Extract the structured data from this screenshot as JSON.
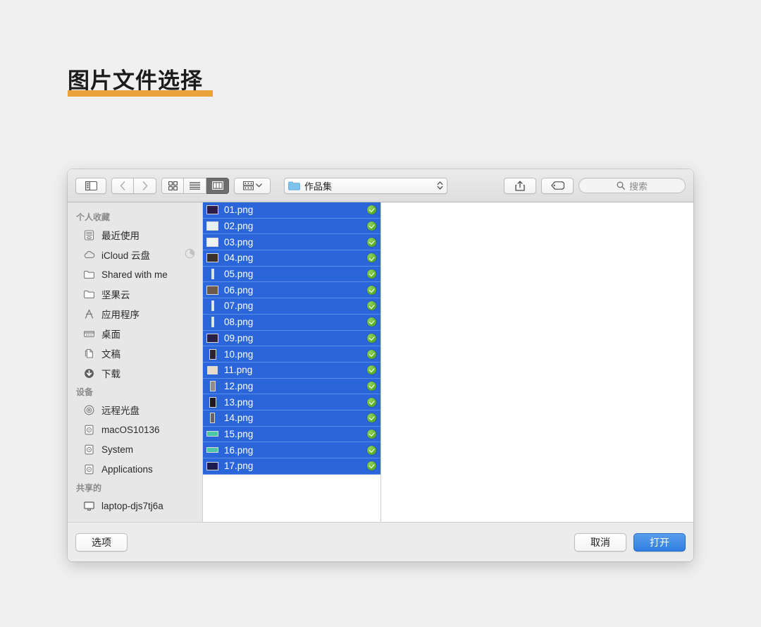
{
  "page": {
    "heading": "图片文件选择",
    "heading_underline_color": "#eaa33c",
    "background_color": "#f0f0f0"
  },
  "dialog": {
    "toolbar": {
      "sidebar_toggle": "sidebar-toggle",
      "back_label": "‹",
      "forward_label": "›",
      "view_modes": [
        {
          "name": "icon-view",
          "active": false
        },
        {
          "name": "list-view",
          "active": false
        },
        {
          "name": "column-view",
          "active": true
        }
      ],
      "group_button": "group-by",
      "path_popup": {
        "label": "作品集",
        "folder_color": "#6cb8e8"
      },
      "share_button": "share",
      "tag_button": "tag",
      "search": {
        "placeholder": "搜索"
      }
    },
    "sidebar": {
      "sections": [
        {
          "title": "个人收藏",
          "items": [
            {
              "label": "最近使用",
              "icon": "recents-icon"
            },
            {
              "label": "iCloud 云盘",
              "icon": "icloud-icon",
              "badge": "sync-progress"
            },
            {
              "label": "Shared with me",
              "icon": "folder-icon"
            },
            {
              "label": "坚果云",
              "icon": "folder-icon"
            },
            {
              "label": "应用程序",
              "icon": "applications-icon"
            },
            {
              "label": "桌面",
              "icon": "desktop-icon"
            },
            {
              "label": "文稿",
              "icon": "documents-icon"
            },
            {
              "label": "下载",
              "icon": "downloads-icon"
            }
          ]
        },
        {
          "title": "设备",
          "items": [
            {
              "label": "远程光盘",
              "icon": "disc-icon"
            },
            {
              "label": "macOS10136",
              "icon": "harddisk-icon"
            },
            {
              "label": "System",
              "icon": "harddisk-icon"
            },
            {
              "label": "Applications",
              "icon": "harddisk-icon"
            }
          ]
        },
        {
          "title": "共享的",
          "items": [
            {
              "label": "laptop-djs7tj6a",
              "icon": "display-icon"
            }
          ]
        }
      ]
    },
    "file_list": {
      "selected_all": true,
      "files": [
        {
          "name": "01.png",
          "selected": true,
          "checked": true,
          "thumb": {
            "w": 17,
            "h": 13,
            "color": "#2d1a47"
          }
        },
        {
          "name": "02.png",
          "selected": true,
          "checked": true,
          "thumb": {
            "w": 17,
            "h": 13,
            "color": "#e8eef5"
          }
        },
        {
          "name": "03.png",
          "selected": true,
          "checked": true,
          "thumb": {
            "w": 17,
            "h": 13,
            "color": "#eef2f6"
          }
        },
        {
          "name": "04.png",
          "selected": true,
          "checked": true,
          "thumb": {
            "w": 17,
            "h": 13,
            "color": "#3a2f2a"
          }
        },
        {
          "name": "05.png",
          "selected": true,
          "checked": true,
          "thumb": {
            "w": 4,
            "h": 15,
            "color": "#dfe6ee"
          }
        },
        {
          "name": "06.png",
          "selected": true,
          "checked": true,
          "thumb": {
            "w": 17,
            "h": 13,
            "color": "#6d5a4a"
          }
        },
        {
          "name": "07.png",
          "selected": true,
          "checked": true,
          "thumb": {
            "w": 4,
            "h": 15,
            "color": "#e4eaf2"
          }
        },
        {
          "name": "08.png",
          "selected": true,
          "checked": true,
          "thumb": {
            "w": 4,
            "h": 15,
            "color": "#e4eaf2"
          }
        },
        {
          "name": "09.png",
          "selected": true,
          "checked": true,
          "thumb": {
            "w": 17,
            "h": 13,
            "color": "#2a1f4a"
          }
        },
        {
          "name": "10.png",
          "selected": true,
          "checked": true,
          "thumb": {
            "w": 10,
            "h": 15,
            "color": "#2b2438"
          }
        },
        {
          "name": "11.png",
          "selected": true,
          "checked": true,
          "thumb": {
            "w": 15,
            "h": 12,
            "color": "#e8d9c8"
          }
        },
        {
          "name": "12.png",
          "selected": true,
          "checked": true,
          "thumb": {
            "w": 8,
            "h": 15,
            "color": "#8d8d86"
          }
        },
        {
          "name": "13.png",
          "selected": true,
          "checked": true,
          "thumb": {
            "w": 10,
            "h": 15,
            "color": "#1d1a1e"
          }
        },
        {
          "name": "14.png",
          "selected": true,
          "checked": true,
          "thumb": {
            "w": 7,
            "h": 15,
            "color": "#6b625c"
          }
        },
        {
          "name": "15.png",
          "selected": true,
          "checked": true,
          "thumb": {
            "w": 17,
            "h": 8,
            "color": "#49c7a6"
          }
        },
        {
          "name": "16.png",
          "selected": true,
          "checked": true,
          "thumb": {
            "w": 17,
            "h": 8,
            "color": "#49c7a6"
          }
        },
        {
          "name": "17.png",
          "selected": true,
          "checked": true,
          "thumb": {
            "w": 17,
            "h": 12,
            "color": "#1e1a52"
          }
        }
      ]
    },
    "bottom_bar": {
      "options_label": "选项",
      "cancel_label": "取消",
      "open_label": "打开",
      "default_button_color": "#3f86e3"
    }
  }
}
